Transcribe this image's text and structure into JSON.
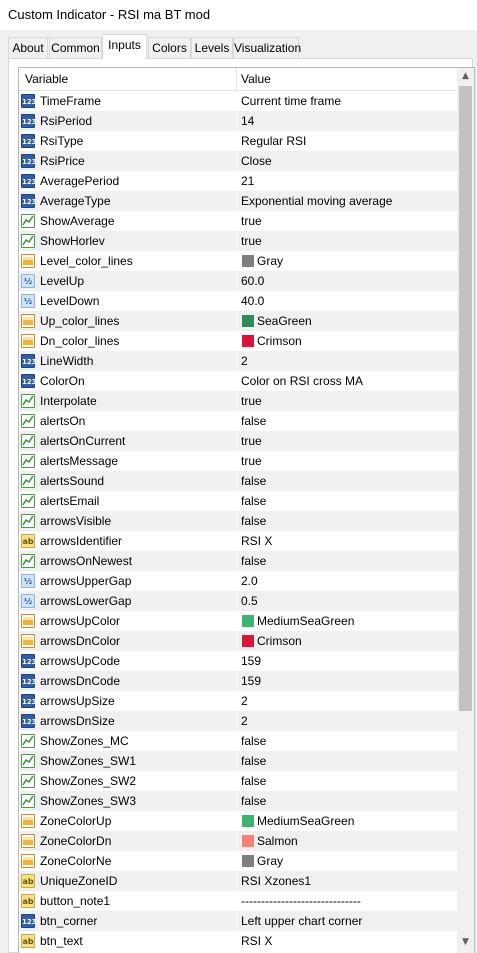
{
  "window": {
    "title": "Custom Indicator - RSI ma BT mod"
  },
  "tabs": [
    {
      "label": "About"
    },
    {
      "label": "Common"
    },
    {
      "label": "Inputs"
    },
    {
      "label": "Colors"
    },
    {
      "label": "Levels"
    },
    {
      "label": "Visualization"
    }
  ],
  "grid": {
    "col_variable": "Variable",
    "col_value": "Value",
    "rows": [
      {
        "name": "TimeFrame",
        "value": "Current time frame",
        "type": "int",
        "icon": "int-icon"
      },
      {
        "name": "RsiPeriod",
        "value": "14",
        "type": "int",
        "icon": "int-icon"
      },
      {
        "name": "RsiType",
        "value": "Regular RSI",
        "type": "int",
        "icon": "int-icon"
      },
      {
        "name": "RsiPrice",
        "value": "Close",
        "type": "int",
        "icon": "int-icon"
      },
      {
        "name": "AveragePeriod",
        "value": "21",
        "type": "int",
        "icon": "int-icon"
      },
      {
        "name": "AverageType",
        "value": "Exponential moving average",
        "type": "int",
        "icon": "int-icon"
      },
      {
        "name": "ShowAverage",
        "value": "true",
        "type": "bool",
        "icon": "bool-icon"
      },
      {
        "name": "ShowHorlev",
        "value": "true",
        "type": "bool",
        "icon": "bool-icon"
      },
      {
        "name": "Level_color_lines",
        "value": "Gray",
        "type": "color",
        "icon": "color-icon",
        "swatch": "#808080"
      },
      {
        "name": "LevelUp",
        "value": "60.0",
        "type": "dbl",
        "icon": "double-icon"
      },
      {
        "name": "LevelDown",
        "value": "40.0",
        "type": "dbl",
        "icon": "double-icon"
      },
      {
        "name": "Up_color_lines",
        "value": "SeaGreen",
        "type": "color",
        "icon": "color-icon",
        "swatch": "#2e8b57"
      },
      {
        "name": "Dn_color_lines",
        "value": "Crimson",
        "type": "color",
        "icon": "color-icon",
        "swatch": "#dc143c"
      },
      {
        "name": "LineWidth",
        "value": "2",
        "type": "int",
        "icon": "int-icon"
      },
      {
        "name": "ColorOn",
        "value": "Color on RSI cross MA",
        "type": "int",
        "icon": "int-icon"
      },
      {
        "name": "Interpolate",
        "value": "true",
        "type": "bool",
        "icon": "bool-icon"
      },
      {
        "name": "alertsOn",
        "value": "false",
        "type": "bool",
        "icon": "bool-icon"
      },
      {
        "name": "alertsOnCurrent",
        "value": "true",
        "type": "bool",
        "icon": "bool-icon"
      },
      {
        "name": "alertsMessage",
        "value": "true",
        "type": "bool",
        "icon": "bool-icon"
      },
      {
        "name": "alertsSound",
        "value": "false",
        "type": "bool",
        "icon": "bool-icon"
      },
      {
        "name": "alertsEmail",
        "value": "false",
        "type": "bool",
        "icon": "bool-icon"
      },
      {
        "name": "arrowsVisible",
        "value": "false",
        "type": "bool",
        "icon": "bool-icon"
      },
      {
        "name": "arrowsIdentifier",
        "value": " RSI X",
        "type": "str",
        "icon": "string-icon"
      },
      {
        "name": "arrowsOnNewest",
        "value": "false",
        "type": "bool",
        "icon": "bool-icon"
      },
      {
        "name": "arrowsUpperGap",
        "value": "2.0",
        "type": "dbl",
        "icon": "double-icon"
      },
      {
        "name": "arrowsLowerGap",
        "value": "0.5",
        "type": "dbl",
        "icon": "double-icon"
      },
      {
        "name": "arrowsUpColor",
        "value": "MediumSeaGreen",
        "type": "color",
        "icon": "color-icon",
        "swatch": "#3cb371"
      },
      {
        "name": "arrowsDnColor",
        "value": "Crimson",
        "type": "color",
        "icon": "color-icon",
        "swatch": "#dc143c"
      },
      {
        "name": "arrowsUpCode",
        "value": "159",
        "type": "int",
        "icon": "int-icon"
      },
      {
        "name": "arrowsDnCode",
        "value": "159",
        "type": "int",
        "icon": "int-icon"
      },
      {
        "name": "arrowsUpSize",
        "value": "2",
        "type": "int",
        "icon": "int-icon"
      },
      {
        "name": "arrowsDnSize",
        "value": "2",
        "type": "int",
        "icon": "int-icon"
      },
      {
        "name": "ShowZones_MC",
        "value": "false",
        "type": "bool",
        "icon": "bool-icon"
      },
      {
        "name": "ShowZones_SW1",
        "value": "false",
        "type": "bool",
        "icon": "bool-icon"
      },
      {
        "name": "ShowZones_SW2",
        "value": "false",
        "type": "bool",
        "icon": "bool-icon"
      },
      {
        "name": "ShowZones_SW3",
        "value": "false",
        "type": "bool",
        "icon": "bool-icon"
      },
      {
        "name": "ZoneColorUp",
        "value": "MediumSeaGreen",
        "type": "color",
        "icon": "color-icon",
        "swatch": "#3cb371"
      },
      {
        "name": "ZoneColorDn",
        "value": "Salmon",
        "type": "color",
        "icon": "color-icon",
        "swatch": "#fa8072"
      },
      {
        "name": "ZoneColorNe",
        "value": "Gray",
        "type": "color",
        "icon": "color-icon",
        "swatch": "#808080"
      },
      {
        "name": "UniqueZoneID",
        "value": "RSI Xzones1",
        "type": "str",
        "icon": "string-icon"
      },
      {
        "name": "button_note1",
        "value": "------------------------------",
        "type": "str",
        "icon": "string-icon"
      },
      {
        "name": "btn_corner",
        "value": "Left upper chart corner",
        "type": "int",
        "icon": "int-icon"
      },
      {
        "name": "btn_text",
        "value": "RSI  X",
        "type": "str",
        "icon": "string-icon"
      }
    ]
  },
  "icon_labels": {
    "int": "123",
    "dbl": "½",
    "str": "ab"
  },
  "scrollbar": {
    "up_glyph": "▲",
    "down_glyph": "▼"
  }
}
